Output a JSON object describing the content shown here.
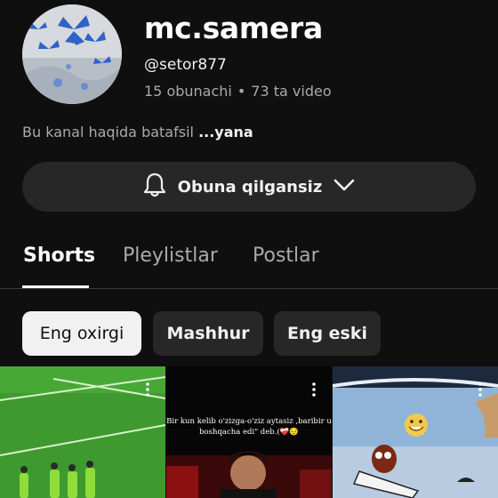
{
  "channel": {
    "name": "mc.samera",
    "handle": "@setor877",
    "subscribers": "15 obunachi",
    "separator": "•",
    "videos": "73 ta video",
    "about_text": "Bu kanal haqida batafsil",
    "about_more": "...yana"
  },
  "subscribe_button": {
    "label": "Obuna qilgansiz",
    "bell_icon": "bell-icon",
    "chevron_icon": "chevron-down-icon"
  },
  "tabs": [
    {
      "label": "Shorts",
      "active": true
    },
    {
      "label": "Pleylistlar",
      "active": false
    },
    {
      "label": "Postlar",
      "active": false
    }
  ],
  "filters": [
    {
      "label": "Eng oxirgi",
      "selected": true
    },
    {
      "label": "Mashhur",
      "selected": false
    },
    {
      "label": "Eng eski",
      "selected": false
    }
  ],
  "shorts": [
    {
      "theme": "football-field"
    },
    {
      "caption": "Bir kun kelib o'zizga-o'ziz aytasiz ,baribir u boshqacha edi\" deb.(❤️‍🩹😔"
    },
    {
      "emoji": "😁"
    }
  ],
  "colors": {
    "background": "#0f0f0f",
    "chip": "#272727",
    "chip_selected": "#f1f1f1",
    "secondary_text": "#aaaaaa"
  }
}
